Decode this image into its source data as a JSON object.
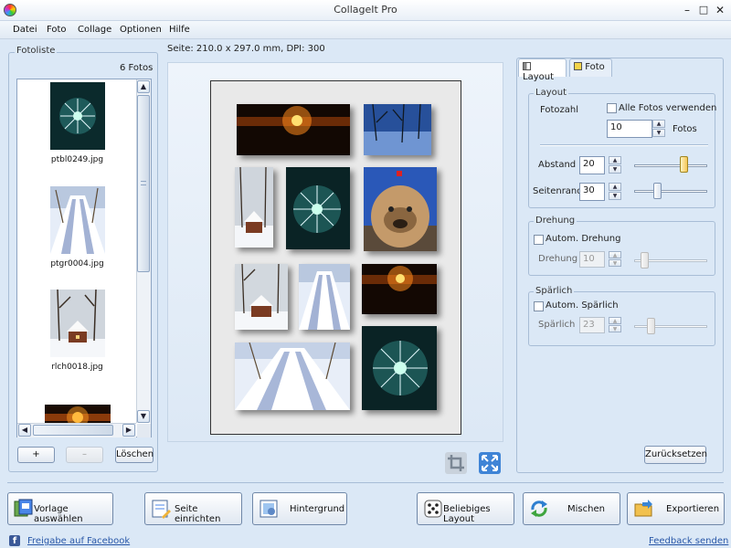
{
  "window": {
    "title": "CollageIt Pro",
    "min_glyph": "–",
    "max_glyph": "□",
    "close_glyph": "✕"
  },
  "menu": [
    "Datei",
    "Foto",
    "Collage",
    "Optionen",
    "Hilfe"
  ],
  "fotoliste": {
    "title": "Fotoliste",
    "count": "6 Fotos",
    "items": [
      {
        "name": "ptbl0249.jpg",
        "icon": "dandelion-photo"
      },
      {
        "name": "ptgr0004.jpg",
        "icon": "snow-path-photo"
      },
      {
        "name": "rlch0018.jpg",
        "icon": "snow-house-photo"
      },
      {
        "name": "",
        "icon": "sunset-photo"
      }
    ],
    "add_label": "+",
    "remove_label": "–",
    "delete_label": "Löschen"
  },
  "page_info": "Seite: 210.0 x 297.0 mm, DPI: 300",
  "collage_photos": [
    "sunset",
    "winter-trees",
    "snow-house",
    "dandelion",
    "dog",
    "snow-house",
    "snow-path",
    "sunset",
    "snow-path",
    "dandelion"
  ],
  "tabs": {
    "layout": "Layout",
    "foto": "Foto",
    "active": "layout"
  },
  "layout_group": {
    "title": "Layout",
    "fotozahl_label": "Fotozahl",
    "alle_fotos_label": "Alle Fotos verwenden",
    "alle_fotos_checked": false,
    "fotozahl_value": "10",
    "fotos_label": "Fotos",
    "abstand_label": "Abstand",
    "abstand_value": "20",
    "abstand_level": 0.7,
    "seitenrand_label": "Seitenrand",
    "seitenrand_value": "30",
    "seitenrand_level": 0.3
  },
  "drehung_group": {
    "title": "Drehung",
    "auto_label": "Autom. Drehung",
    "auto_checked": false,
    "value_label": "Drehung",
    "value": "10",
    "level": 0.1
  },
  "spaerlich_group": {
    "title": "Spärlich",
    "auto_label": "Autom. Spärlich",
    "auto_checked": false,
    "value_label": "Spärlich",
    "value": "23",
    "level": 0.2
  },
  "reset_label": "Zurücksetzen",
  "bottom_buttons": {
    "vorlage": "Vorlage auswählen",
    "seite": "Seite einrichten",
    "hintergrund": "Hintergrund",
    "beliebig": "Beliebiges Layout",
    "mischen": "Mischen",
    "exportieren": "Exportieren"
  },
  "footer": {
    "facebook": "Freigabe auf Facebook",
    "feedback": "Feedback senden"
  },
  "colors": {
    "accent": "#2a58a8",
    "panel_bg": "#dbe8f6",
    "border": "#a8bdd6"
  }
}
